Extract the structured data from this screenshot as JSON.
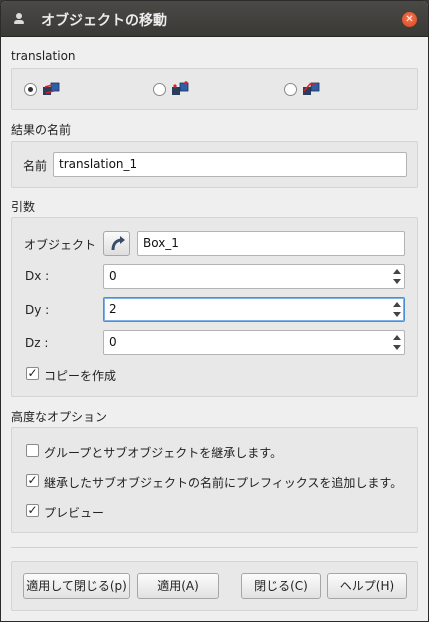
{
  "window": {
    "title": "オブジェクトの移動",
    "close_icon": "close-icon",
    "app_icon": "person-icon"
  },
  "translation": {
    "section_label": "translation",
    "options": [
      {
        "icon": "translate-vector-icon",
        "checked": true
      },
      {
        "icon": "translate-two-points-icon",
        "checked": false
      },
      {
        "icon": "translate-dxdydz-icon",
        "checked": false
      }
    ]
  },
  "result": {
    "section_label": "結果の名前",
    "name_label": "名前",
    "name_value": "translation_1"
  },
  "args": {
    "section_label": "引数",
    "object_label": "オブジェクト",
    "object_value": "Box_1",
    "dx_label": "Dx :",
    "dx_value": "0",
    "dy_label": "Dy :",
    "dy_value": "2",
    "dz_label": "Dz :",
    "dz_value": "0",
    "copy_label": "コピーを作成",
    "copy_checked": true
  },
  "advanced": {
    "section_label": "高度なオプション",
    "inherit_label": "グループとサブオブジェクトを継承します。",
    "inherit_checked": false,
    "prefix_label": "継承したサブオブジェクトの名前にプレフィックスを追加します。",
    "prefix_checked": true,
    "preview_label": "プレビュー",
    "preview_checked": true
  },
  "buttons": {
    "apply_close": "適用して閉じる(p)",
    "apply": "適用(A)",
    "close": "閉じる(C)",
    "help": "ヘルプ(H)"
  },
  "colors": {
    "accent": "#4a90d9",
    "close_button": "#e3572c",
    "titlebar": "#3f3e3a"
  }
}
